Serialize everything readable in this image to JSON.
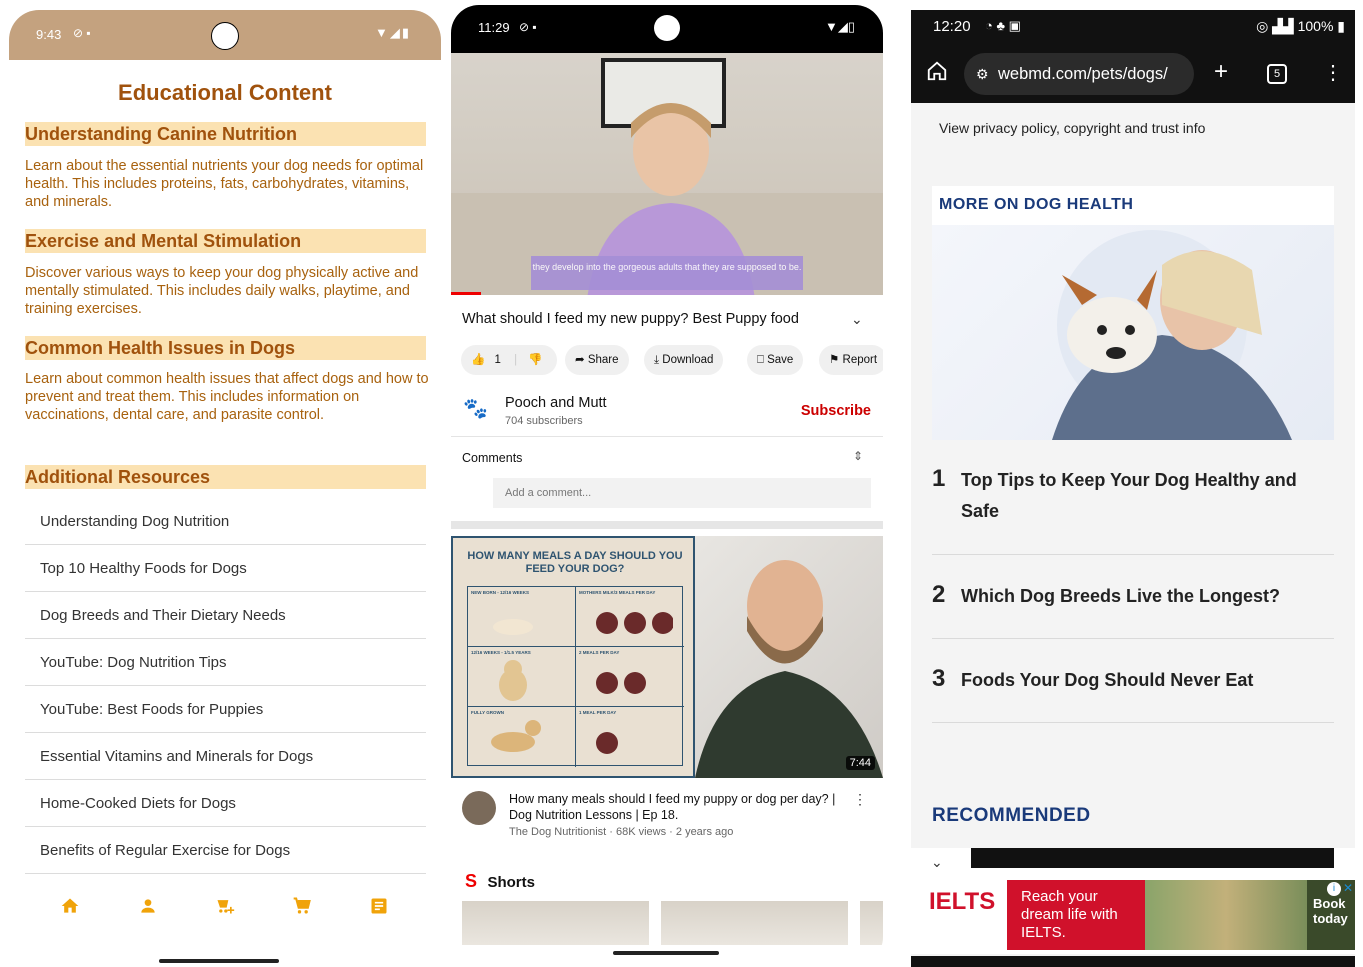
{
  "phone1": {
    "status_time": "9:43",
    "title": "Educational Content",
    "sections": [
      {
        "heading": "Understanding Canine Nutrition",
        "body": "Learn about the essential nutrients your dog needs for optimal health. This includes proteins, fats, carbohydrates, vitamins, and minerals."
      },
      {
        "heading": "Exercise and Mental Stimulation",
        "body": "Discover various ways to keep your dog physically active and mentally stimulated. This includes daily walks, playtime, and training exercises."
      },
      {
        "heading": "Common Health Issues in Dogs",
        "body": "Learn about common health issues that affect dogs and how to prevent and treat them. This includes information on vaccinations, dental care, and parasite control."
      }
    ],
    "resources_heading": "Additional Resources",
    "resources": [
      "Understanding Dog Nutrition",
      "Top 10 Healthy Foods for Dogs",
      "Dog Breeds and Their Dietary Needs",
      "YouTube: Dog Nutrition Tips",
      "YouTube: Best Foods for Puppies",
      "Essential Vitamins and Minerals for Dogs",
      "Home-Cooked Diets for Dogs",
      "Benefits of Regular Exercise for Dogs"
    ],
    "nav_icons": [
      "home-icon",
      "person-icon",
      "add-to-cart-icon",
      "cart-icon",
      "article-icon"
    ],
    "accent": "#f0a30a"
  },
  "phone2": {
    "status_time": "11:29",
    "video_caption": "they develop into the gorgeous adults that they are supposed to be.",
    "video_title": "What should I feed my new puppy? Best Puppy food",
    "like_count": "1",
    "actions": [
      "Share",
      "Download",
      "Save",
      "Report"
    ],
    "channel_name": "Pooch and Mutt",
    "subscribers": "704 subscribers",
    "subscribe_label": "Subscribe",
    "comments_label": "Comments",
    "comment_placeholder": "Add a comment...",
    "thumb_heading": "HOW MANY MEALS A DAY SHOULD YOU FEED YOUR DOG?",
    "thumb_cells": [
      "NEW BORN - 12/16 WEEKS",
      "MOTHERS MILK/3 MEALS PER DAY",
      "12/16 WEEKS - 1/1.5 YEARS",
      "2 MEALS PER DAY",
      "FULLY GROWN",
      "1 MEAL PER DAY"
    ],
    "duration": "7:44",
    "video2_title": "How many meals should I feed my puppy or dog per day? | Dog Nutrition Lessons | Ep 18.",
    "video2_meta": "The Dog Nutritionist · 68K views · 2 years ago",
    "shorts_label": "Shorts"
  },
  "phone3": {
    "status_time": "12:20",
    "battery": "100%",
    "url": "webmd.com/pets/dogs/",
    "tab_count": "5",
    "privacy_link": "View privacy policy, copyright and trust info",
    "more_heading": "MORE ON DOG HEALTH",
    "articles": [
      {
        "n": "1",
        "title": "Top Tips to Keep Your Dog Healthy and Safe"
      },
      {
        "n": "2",
        "title": "Which Dog Breeds Live the Longest?"
      },
      {
        "n": "3",
        "title": "Foods Your Dog Should Never Eat"
      }
    ],
    "recommended": "RECOMMENDED",
    "ad_brand": "IELTS",
    "ad_text": "Reach your dream life with IELTS.",
    "ad_cta": "Book today",
    "brand_color": "#1a3a7a"
  }
}
